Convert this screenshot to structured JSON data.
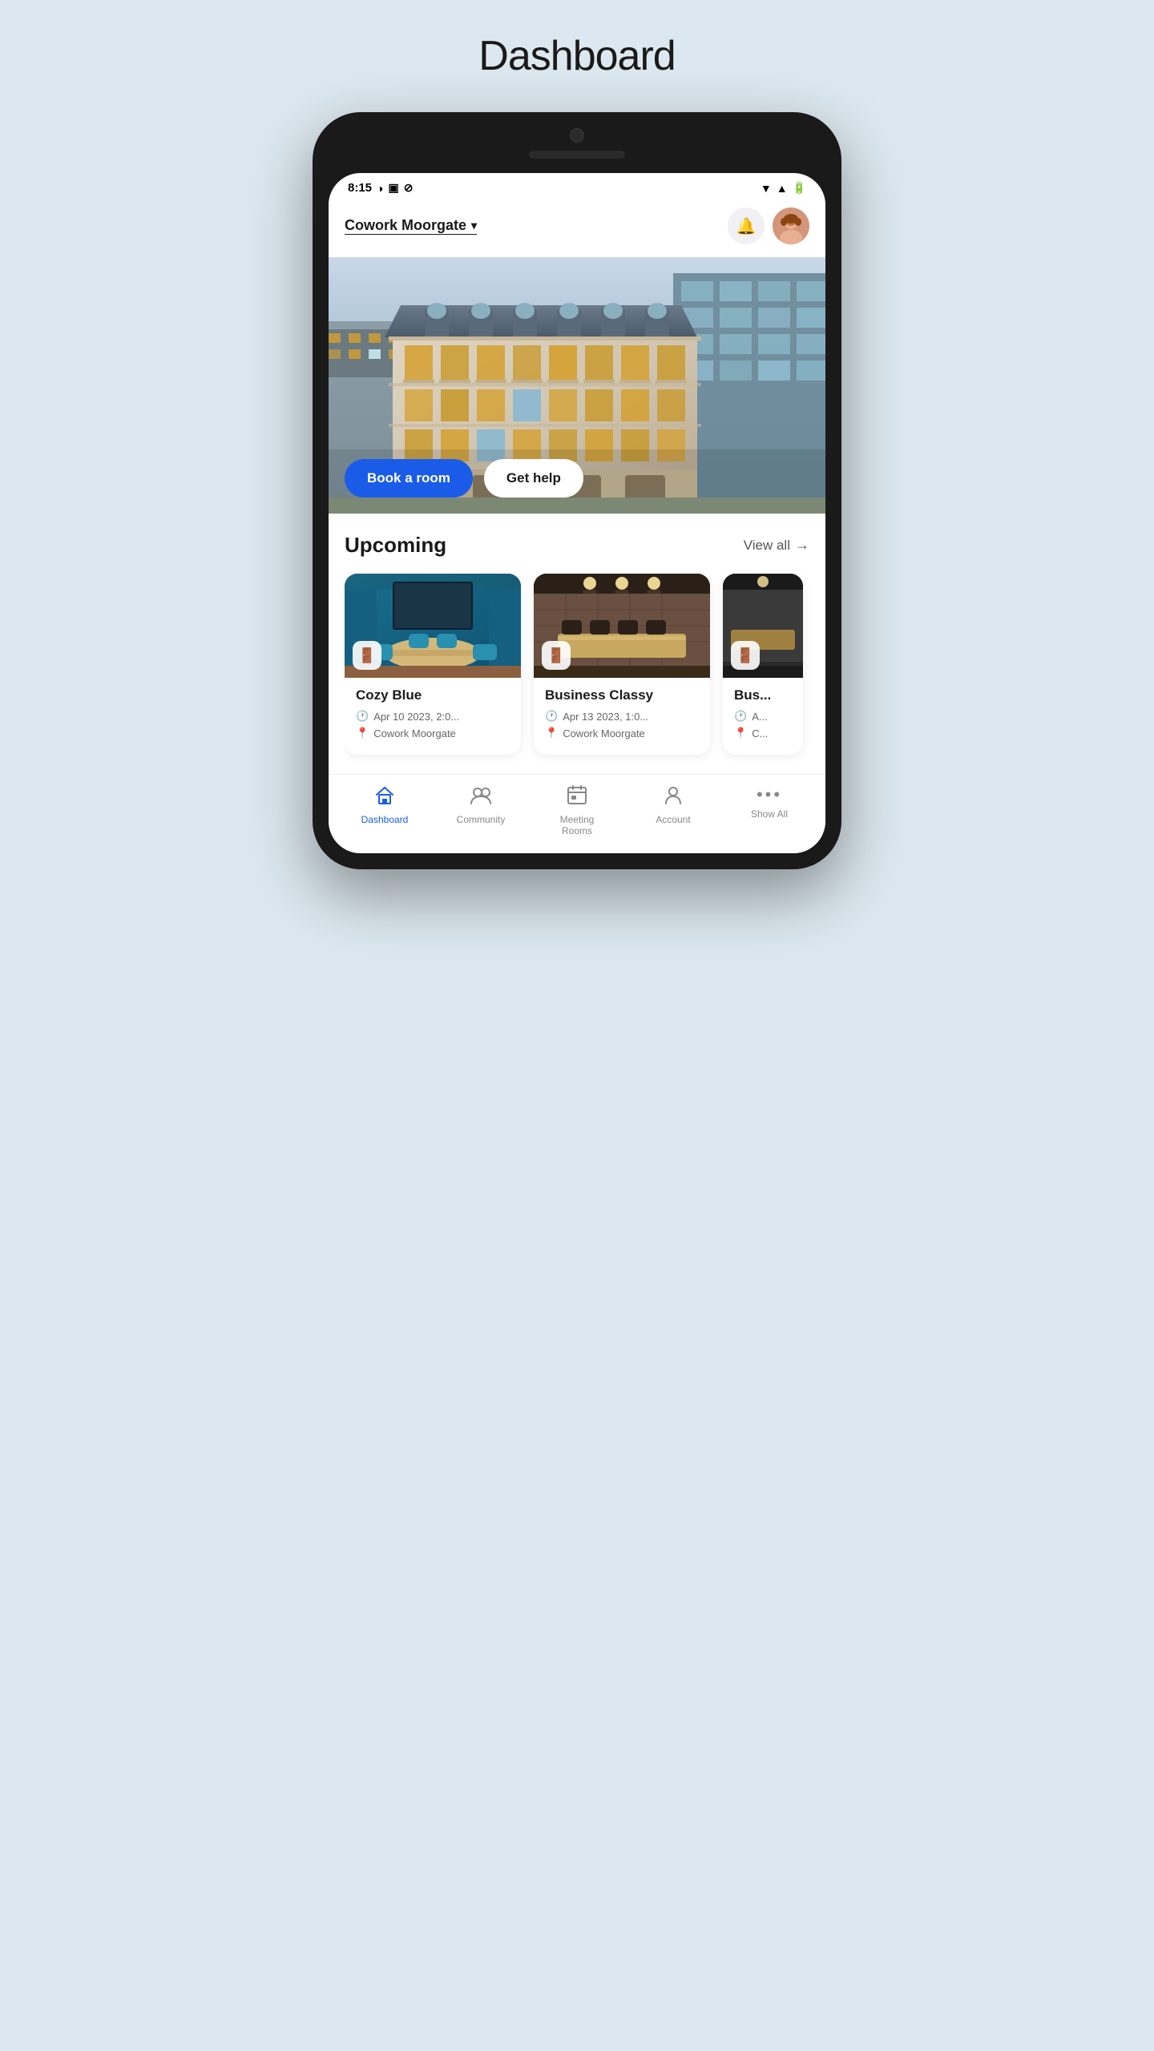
{
  "pageTitle": "Dashboard",
  "statusBar": {
    "time": "8:15",
    "icons": [
      "●",
      "▣",
      "⊘",
      "▼",
      "▲",
      "🔋"
    ]
  },
  "header": {
    "locationName": "Cowork Moorgate",
    "chevron": "▾",
    "bellIcon": "🔔",
    "avatarInitial": "👤"
  },
  "hero": {
    "bookButtonLabel": "Book a room",
    "helpButtonLabel": "Get help"
  },
  "upcoming": {
    "sectionTitle": "Upcoming",
    "viewAllLabel": "View all",
    "rooms": [
      {
        "name": "Cozy Blue",
        "date": "Apr 10 2023, 2:0...",
        "location": "Cowork Moorgate",
        "colorClass": "room-img-cozy"
      },
      {
        "name": "Business Classy",
        "date": "Apr 13 2023, 1:0...",
        "location": "Cowork Moorgate",
        "colorClass": "room-img-business"
      },
      {
        "name": "Bus...",
        "date": "A...",
        "location": "C...",
        "colorClass": "room-img-third"
      }
    ]
  },
  "bottomNav": [
    {
      "id": "dashboard",
      "label": "Dashboard",
      "icon": "🏠",
      "active": true
    },
    {
      "id": "community",
      "label": "Community",
      "icon": "👥",
      "active": false
    },
    {
      "id": "meeting-rooms",
      "label": "Meeting\nRooms",
      "icon": "📅",
      "active": false
    },
    {
      "id": "account",
      "label": "Account",
      "icon": "👤",
      "active": false
    },
    {
      "id": "show-all",
      "label": "Show All",
      "icon": "•••",
      "active": false
    }
  ]
}
